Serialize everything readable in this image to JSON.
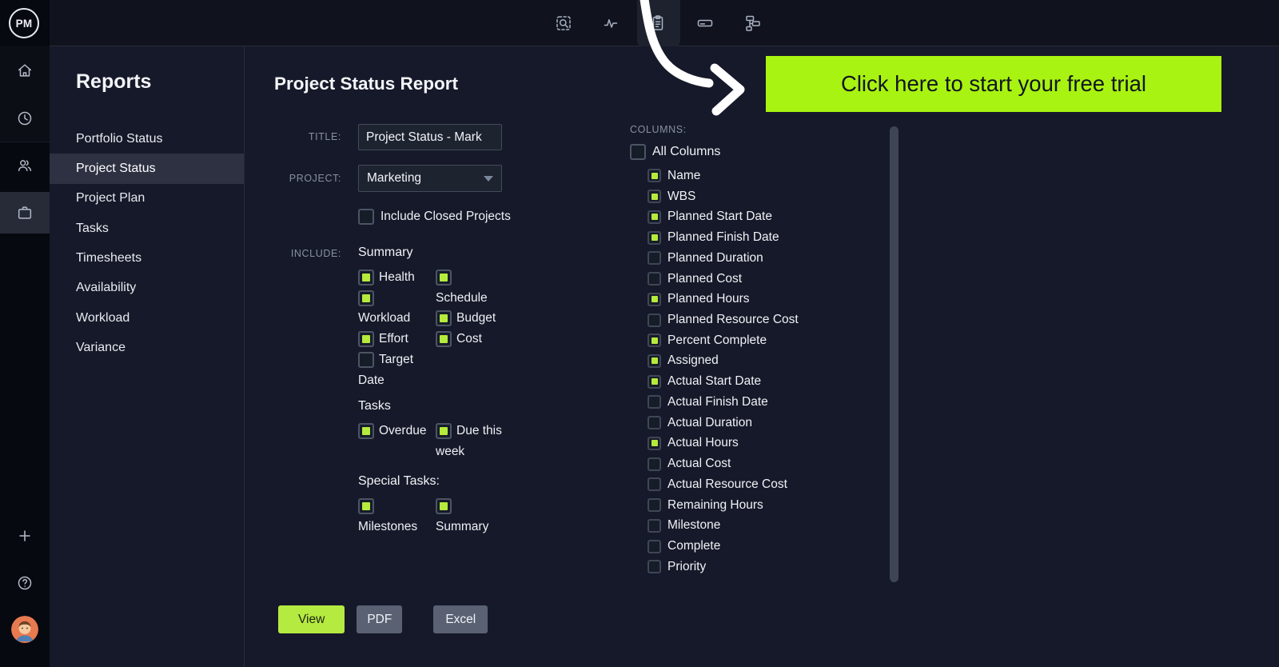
{
  "logo": {
    "text": "PM"
  },
  "topbar": {
    "icons": [
      "selection-search",
      "activity",
      "clipboard",
      "toolbar",
      "sitemap"
    ],
    "active_icon": "clipboard"
  },
  "rail": {
    "icons": [
      "home",
      "clock",
      "team",
      "projects",
      "add",
      "help",
      "avatar"
    ],
    "active_icon": "projects"
  },
  "reports": {
    "title": "Reports",
    "items": [
      {
        "label": "Portfolio Status"
      },
      {
        "label": "Project Status",
        "selected": true
      },
      {
        "label": "Project Plan"
      },
      {
        "label": "Tasks"
      },
      {
        "label": "Timesheets"
      },
      {
        "label": "Availability"
      },
      {
        "label": "Workload"
      },
      {
        "label": "Variance"
      }
    ]
  },
  "main": {
    "title": "Project Status Report",
    "form": {
      "title_label": "TITLE:",
      "title_value": "Project Status - Mark",
      "project_label": "PROJECT:",
      "project_value": "Marketing",
      "include_closed": {
        "label": "Include Closed Projects",
        "checked": false
      },
      "include_label": "INCLUDE:",
      "summary": {
        "heading": "Summary",
        "col1": [
          {
            "label": "Health",
            "checked": true
          },
          {
            "label": "\nWorkload",
            "checked": true
          },
          {
            "label": "Effort",
            "checked": true
          },
          {
            "label": "Target\nDate",
            "checked": false
          }
        ],
        "col2": [
          {
            "label": "\nSchedule",
            "checked": true
          },
          {
            "label": "Budget",
            "checked": true
          },
          {
            "label": "Cost",
            "checked": true
          }
        ]
      },
      "tasks": {
        "heading": "Tasks",
        "col1": [
          {
            "label": "Overdue",
            "checked": true
          }
        ],
        "col2": [
          {
            "label": "Due this\nweek",
            "checked": true
          }
        ]
      },
      "special": {
        "heading": "Special Tasks:",
        "col1": [
          {
            "label": "\nMilestones",
            "checked": true
          }
        ],
        "col2": [
          {
            "label": "\nSummary",
            "checked": true
          }
        ]
      },
      "buttons": [
        {
          "label": "View",
          "primary": true
        },
        {
          "label": "PDF"
        },
        {
          "label": "Excel"
        }
      ]
    },
    "columns": {
      "label": "COLUMNS:",
      "all": {
        "label": "All Columns",
        "checked": false
      },
      "items": [
        {
          "label": "Name",
          "checked": true
        },
        {
          "label": "WBS",
          "checked": true
        },
        {
          "label": "Planned Start Date",
          "checked": true
        },
        {
          "label": "Planned Finish Date",
          "checked": true
        },
        {
          "label": "Planned Duration",
          "checked": false
        },
        {
          "label": "Planned Cost",
          "checked": false
        },
        {
          "label": "Planned Hours",
          "checked": true
        },
        {
          "label": "Planned Resource Cost",
          "checked": false
        },
        {
          "label": "Percent Complete",
          "checked": true
        },
        {
          "label": "Assigned",
          "checked": true
        },
        {
          "label": "Actual Start Date",
          "checked": true
        },
        {
          "label": "Actual Finish Date",
          "checked": false
        },
        {
          "label": "Actual Duration",
          "checked": false
        },
        {
          "label": "Actual Hours",
          "checked": true
        },
        {
          "label": "Actual Cost",
          "checked": false
        },
        {
          "label": "Actual Resource Cost",
          "checked": false
        },
        {
          "label": "Remaining Hours",
          "checked": false
        },
        {
          "label": "Milestone",
          "checked": false
        },
        {
          "label": "Complete",
          "checked": false
        },
        {
          "label": "Priority",
          "checked": false
        }
      ]
    }
  },
  "banner": {
    "text": "Click here to start your free trial"
  },
  "colors": {
    "accent_green": "#a8f311",
    "check_green": "#b5eb3d",
    "panel_bg": "#161929",
    "topbar_bg": "#10131e",
    "rail_bg": "#070910",
    "selected_row": "#2d3142"
  }
}
